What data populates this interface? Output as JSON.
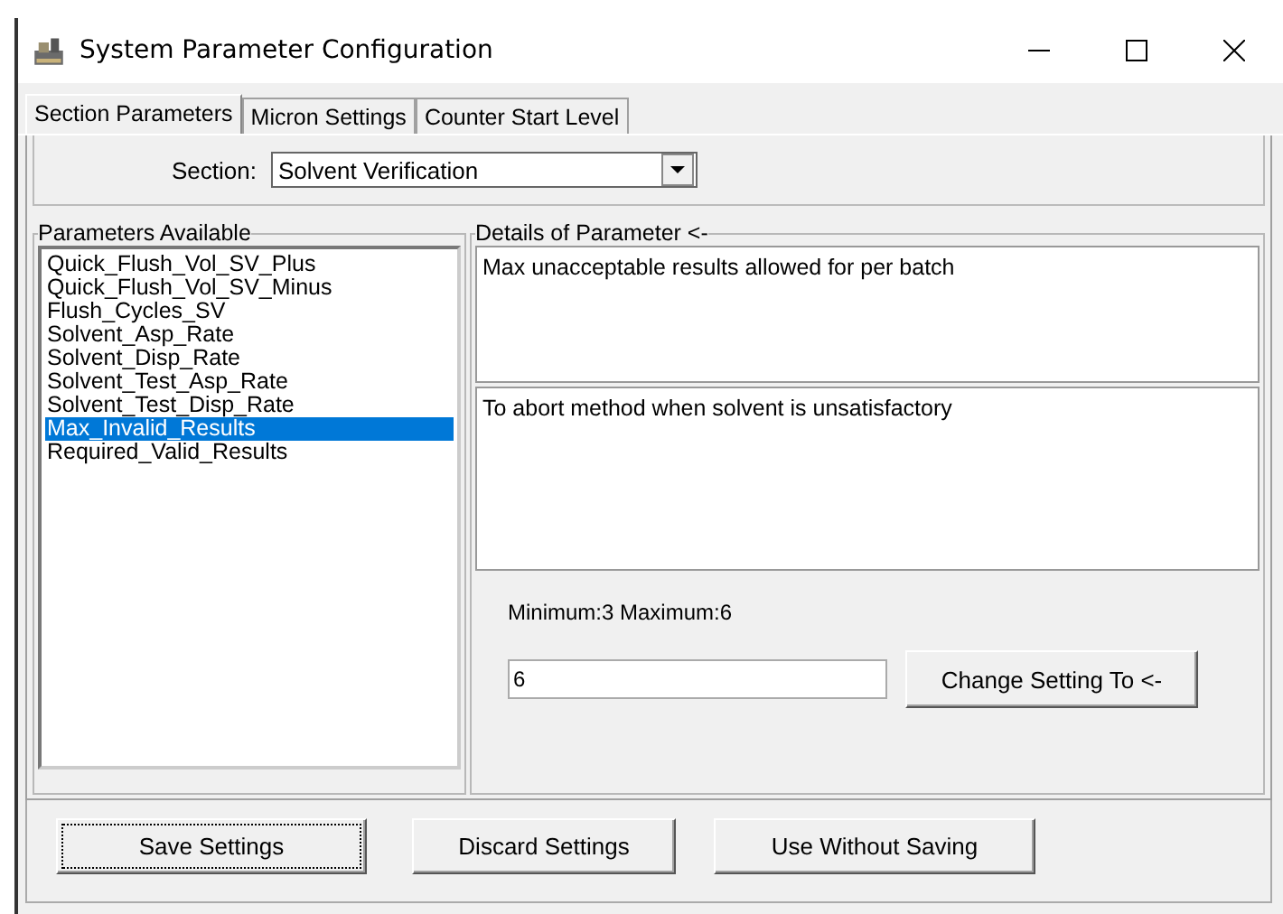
{
  "window": {
    "title": "System Parameter Configuration"
  },
  "tabs": [
    {
      "label": "Section Parameters",
      "selected": true
    },
    {
      "label": "Micron Settings",
      "selected": false
    },
    {
      "label": "Counter Start Level",
      "selected": false
    }
  ],
  "section": {
    "label": "Section:",
    "value": "Solvent Verification"
  },
  "parameters": {
    "title": "Parameters Available",
    "items": [
      {
        "label": "Quick_Flush_Vol_SV_Plus",
        "selected": false
      },
      {
        "label": "Quick_Flush_Vol_SV_Minus",
        "selected": false
      },
      {
        "label": "Flush_Cycles_SV",
        "selected": false
      },
      {
        "label": "Solvent_Asp_Rate",
        "selected": false
      },
      {
        "label": "Solvent_Disp_Rate",
        "selected": false
      },
      {
        "label": "Solvent_Test_Asp_Rate",
        "selected": false
      },
      {
        "label": "Solvent_Test_Disp_Rate",
        "selected": false
      },
      {
        "label": "Max_Invalid_Results",
        "selected": true
      },
      {
        "label": "Required_Valid_Results",
        "selected": false
      }
    ]
  },
  "details": {
    "title": "Details of Parameter <-",
    "description": "Max unacceptable results allowed for per batch",
    "purpose": "To abort method when solvent is unsatisfactory",
    "range": "Minimum:3 Maximum:6",
    "value": "6",
    "apply_button": "Change Setting To <-"
  },
  "buttons": [
    "Save Settings",
    "Discard Settings",
    "Use Without Saving"
  ]
}
